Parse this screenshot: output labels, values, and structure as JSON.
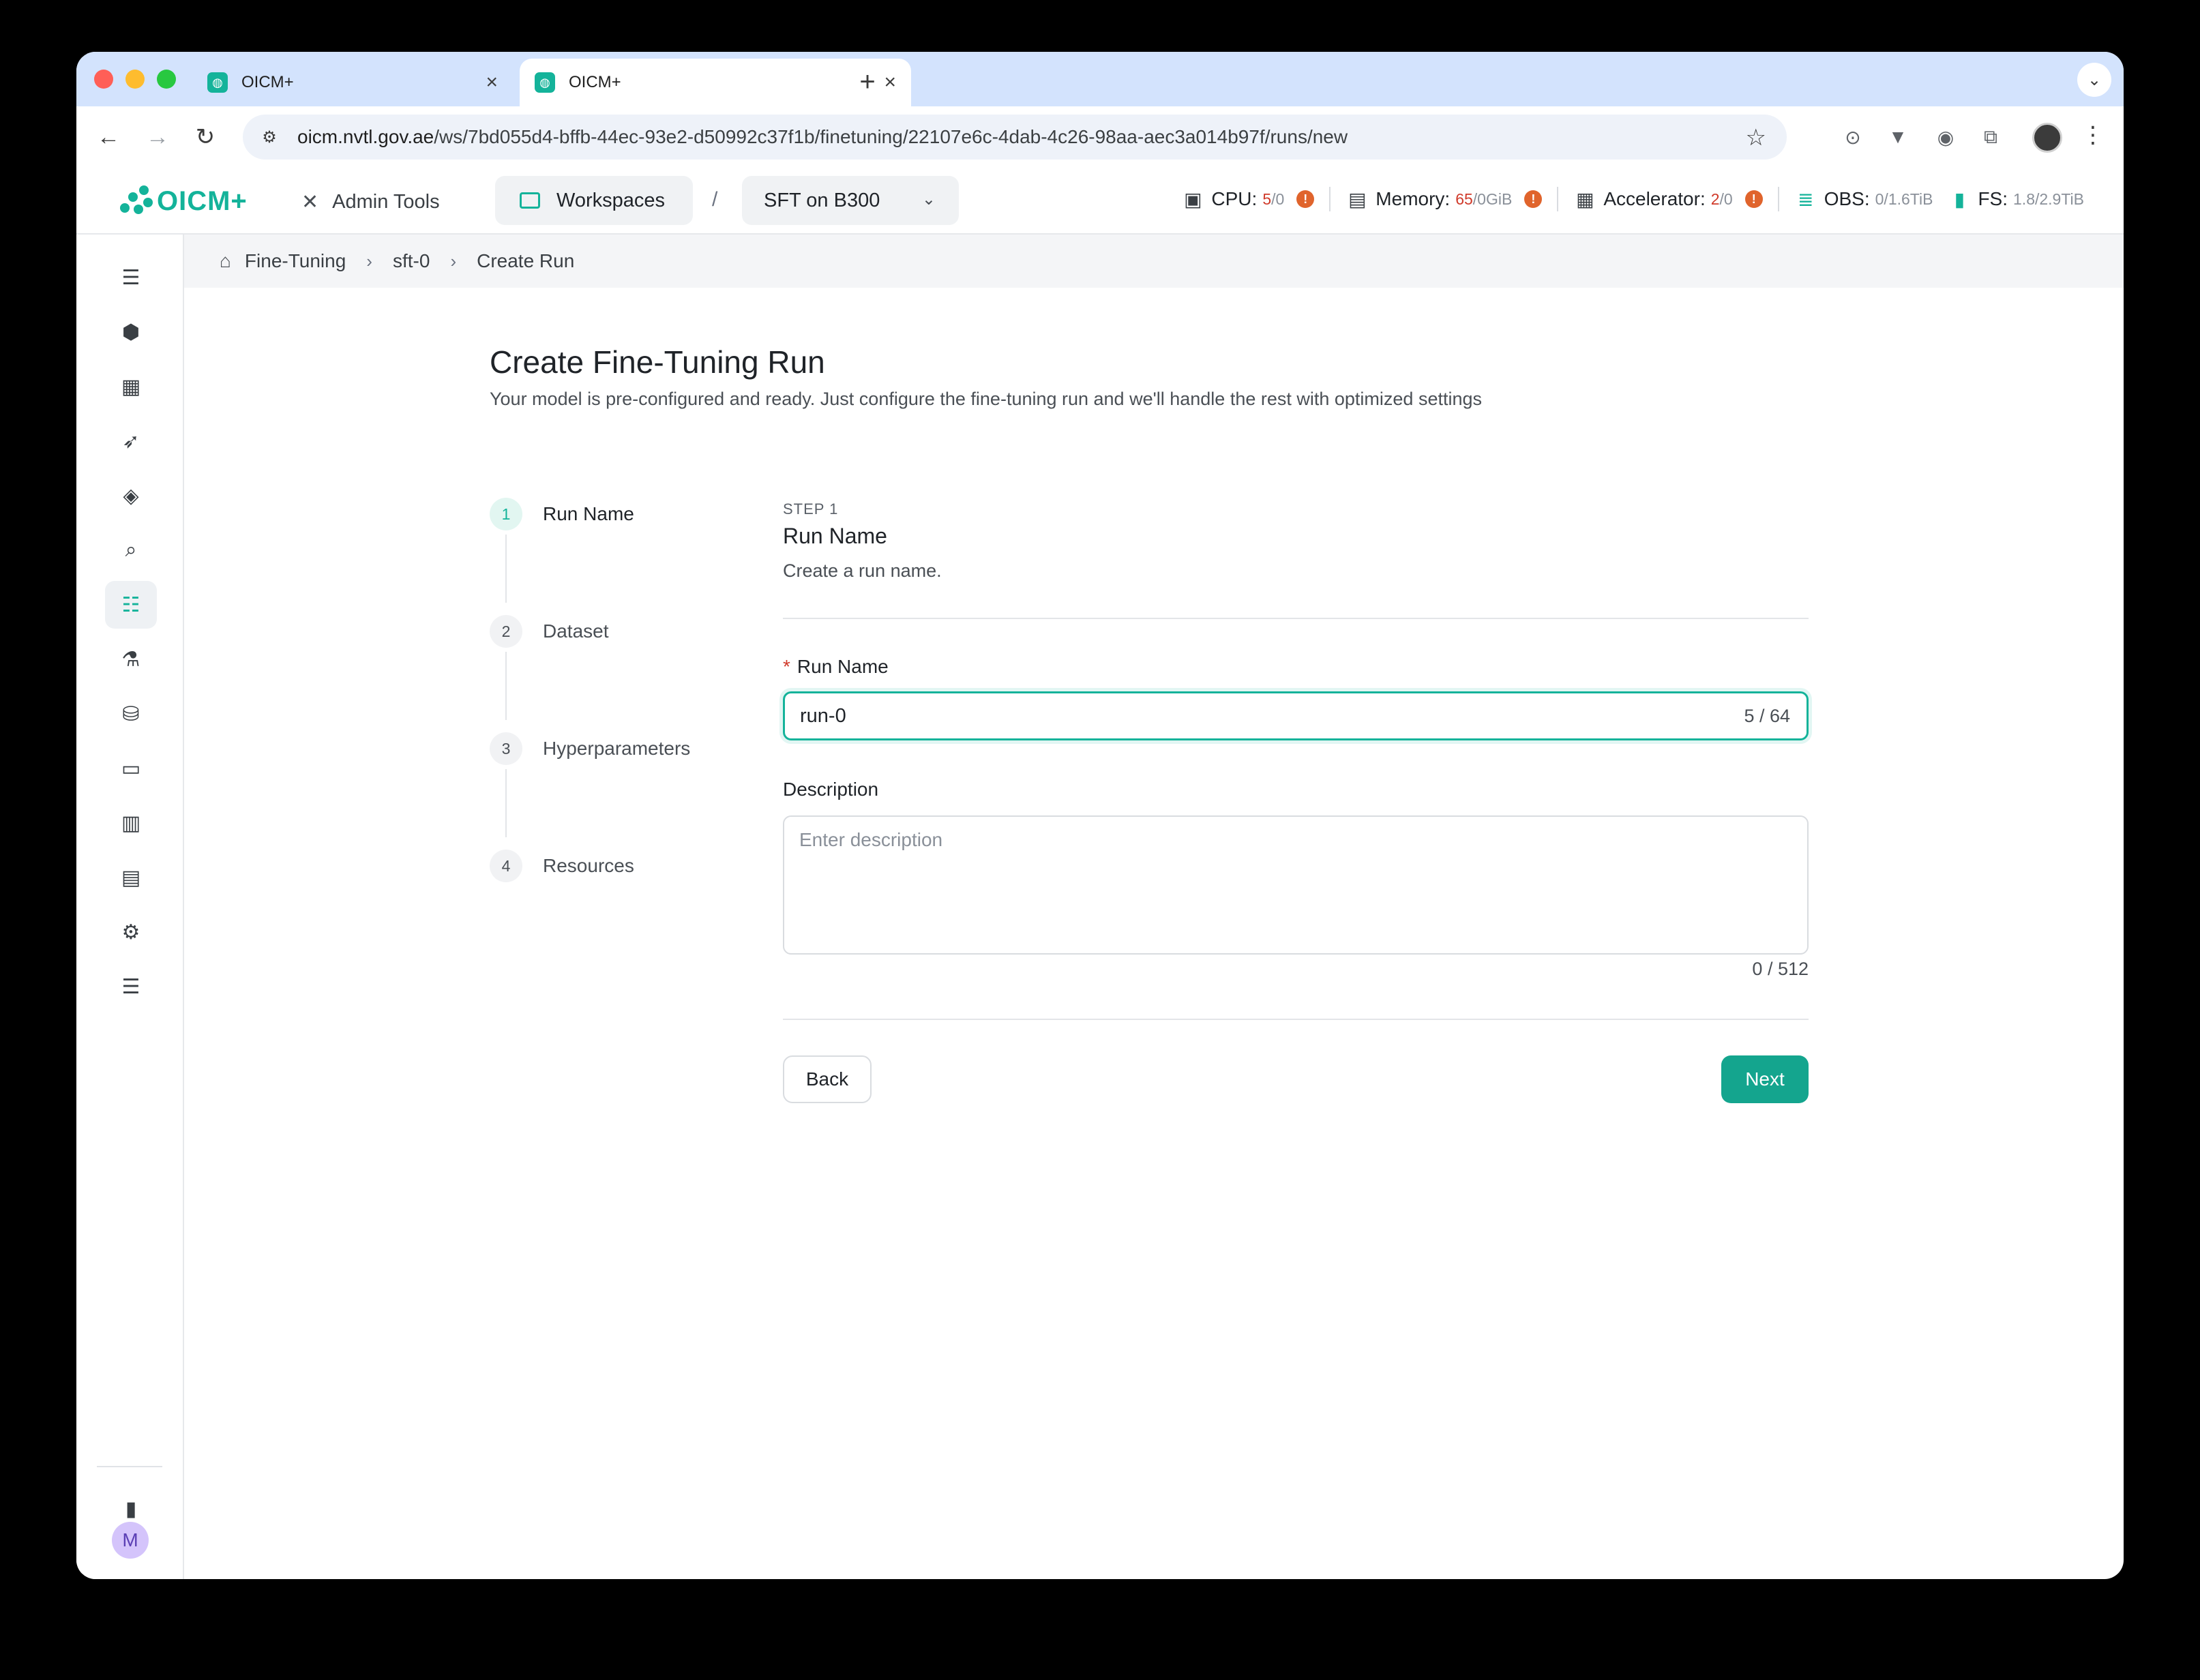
{
  "browser": {
    "tabs": [
      {
        "title": "OICM+",
        "active": false
      },
      {
        "title": "OICM+",
        "active": true
      }
    ],
    "url_domain": "oicm.nvtl.gov.ae",
    "url_path": "/ws/7bd055d4-bffb-44ec-93e2-d50992c37f1b/finetuning/22107e6c-4dab-4c26-98aa-aec3a014b97f/runs/new"
  },
  "header": {
    "logo_text": "OICM+",
    "admin_tools": "Admin Tools",
    "workspaces": "Workspaces",
    "separator": "/",
    "workspace_name": "SFT on B300",
    "resources": {
      "cpu": {
        "label": "CPU:",
        "used": "5",
        "total": "/0"
      },
      "memory": {
        "label": "Memory:",
        "used": "65",
        "total": "/0GiB"
      },
      "accelerator": {
        "label": "Accelerator:",
        "used": "2",
        "total": "/0"
      },
      "obs": {
        "label": "OBS:",
        "value": "0/1.6TiB"
      },
      "fs": {
        "label": "FS:",
        "value": "1.8/2.9TiB"
      }
    }
  },
  "sidebar": {
    "user_initial": "M"
  },
  "breadcrumb": {
    "items": [
      "Fine-Tuning",
      "sft-0",
      "Create Run"
    ]
  },
  "page": {
    "title": "Create Fine-Tuning Run",
    "subtitle": "Your model is pre-configured and ready. Just configure the fine-tuning run and we'll handle the rest with optimized settings"
  },
  "stepper": {
    "steps": [
      {
        "num": "1",
        "label": "Run Name"
      },
      {
        "num": "2",
        "label": "Dataset"
      },
      {
        "num": "3",
        "label": "Hyperparameters"
      },
      {
        "num": "4",
        "label": "Resources"
      }
    ]
  },
  "form": {
    "step_tag": "STEP 1",
    "step_title": "Run Name",
    "step_desc": "Create a run name.",
    "run_name_label": "Run Name",
    "required_mark": "*",
    "run_name_value": "run-0",
    "run_name_count": "5 / 64",
    "description_label": "Description",
    "description_placeholder": "Enter description",
    "description_count": "0 / 512",
    "back_label": "Back",
    "next_label": "Next"
  },
  "colors": {
    "accent": "#14b39a",
    "warning": "#e0642c",
    "danger": "#d03a2a"
  }
}
